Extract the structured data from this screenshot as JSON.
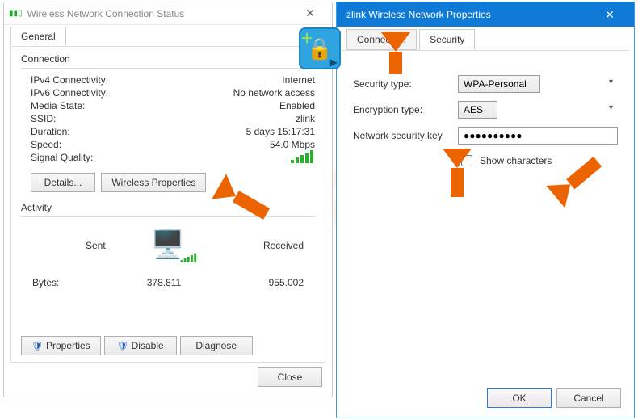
{
  "status_dialog": {
    "title": "Wireless Network Connection Status",
    "tab_general": "General",
    "group_connection": "Connection",
    "rows": {
      "ipv4_label": "IPv4 Connectivity:",
      "ipv4_value": "Internet",
      "ipv6_label": "IPv6 Connectivity:",
      "ipv6_value": "No network access",
      "media_label": "Media State:",
      "media_value": "Enabled",
      "ssid_label": "SSID:",
      "ssid_value": "zlink",
      "duration_label": "Duration:",
      "duration_value": "5 days 15:17:31",
      "speed_label": "Speed:",
      "speed_value": "54.0 Mbps",
      "signal_label": "Signal Quality:"
    },
    "buttons": {
      "details": "Details...",
      "wireless_props": "Wireless Properties"
    },
    "group_activity": "Activity",
    "activity": {
      "sent_label": "Sent",
      "received_label": "Received",
      "bytes_label": "Bytes:",
      "sent_value": "378.811",
      "received_value": "955.002"
    },
    "footer": {
      "properties": "Properties",
      "disable": "Disable",
      "diagnose": "Diagnose",
      "close": "Close"
    }
  },
  "props_dialog": {
    "title": "zlink Wireless Network Properties",
    "tab_connection": "Connection",
    "tab_security": "Security",
    "form": {
      "sec_type_label": "Security type:",
      "sec_type_value": "WPA-Personal",
      "enc_type_label": "Encryption type:",
      "enc_type_value": "AES",
      "key_label": "Network security key",
      "key_value": "●●●●●●●●●●",
      "show_chars": "Show characters"
    },
    "footer": {
      "ok": "OK",
      "cancel": "Cancel"
    }
  },
  "watermark": "pcrisk.com"
}
